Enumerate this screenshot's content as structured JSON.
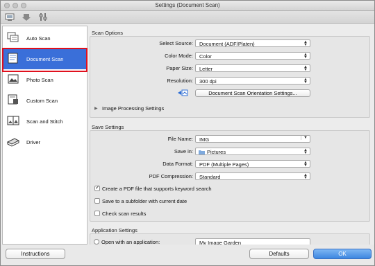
{
  "window": {
    "title": "Settings (Document Scan)"
  },
  "sidebar": {
    "items": [
      {
        "label": "Auto Scan",
        "icon": "auto-scan-icon"
      },
      {
        "label": "Document Scan",
        "icon": "document-scan-icon",
        "selected": true
      },
      {
        "label": "Photo Scan",
        "icon": "photo-scan-icon"
      },
      {
        "label": "Custom Scan",
        "icon": "custom-scan-icon"
      },
      {
        "label": "Scan and Stitch",
        "icon": "scan-and-stitch-icon"
      },
      {
        "label": "Driver",
        "icon": "driver-icon"
      }
    ]
  },
  "scan_options": {
    "title": "Scan Options",
    "select_source": {
      "label": "Select Source:",
      "value": "Document (ADF/Platen)"
    },
    "color_mode": {
      "label": "Color Mode:",
      "value": "Color"
    },
    "paper_size": {
      "label": "Paper Size:",
      "value": "Letter"
    },
    "resolution": {
      "label": "Resolution:",
      "value": "300 dpi"
    },
    "orientation_button": "Document Scan Orientation Settings...",
    "image_processing": "Image Processing Settings"
  },
  "save_settings": {
    "title": "Save Settings",
    "file_name": {
      "label": "File Name:",
      "value": "IMG"
    },
    "save_in": {
      "label": "Save in:",
      "value": "Pictures"
    },
    "data_format": {
      "label": "Data Format:",
      "value": "PDF (Multiple Pages)"
    },
    "pdf_compression": {
      "label": "PDF Compression:",
      "value": "Standard"
    },
    "checkboxes": [
      {
        "label": "Create a PDF file that supports keyword search",
        "checked": true
      },
      {
        "label": "Save to a subfolder with current date",
        "checked": false
      },
      {
        "label": "Check scan results",
        "checked": false
      }
    ]
  },
  "application_settings": {
    "title": "Application Settings",
    "open_with_label": "Open with an application:",
    "open_with_value": "My Image Garden"
  },
  "bottom": {
    "instructions": "Instructions",
    "defaults": "Defaults",
    "ok": "OK"
  },
  "colors": {
    "selection": "#3a6fd9",
    "highlight": "#e0101d",
    "ok_button": "#3d86e0"
  }
}
